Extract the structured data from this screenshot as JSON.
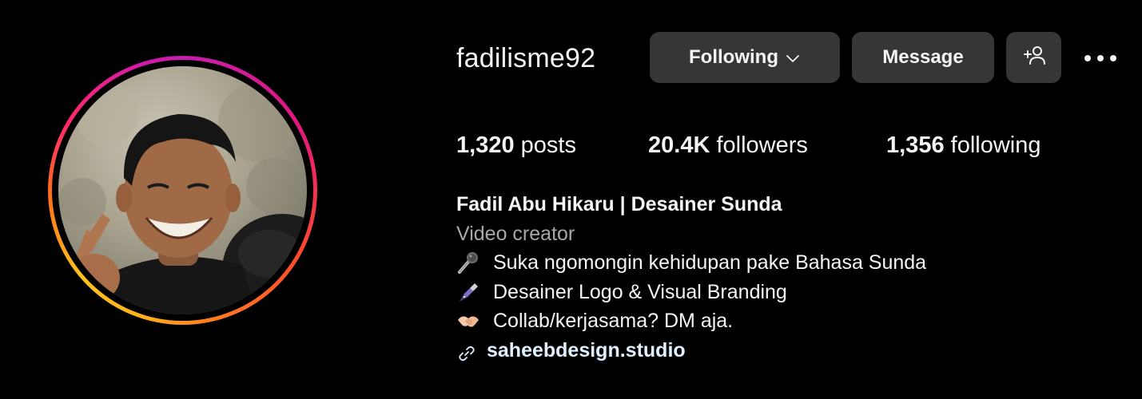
{
  "profile": {
    "username": "fadilisme92",
    "full_name": "Fadil Abu Hikaru | Desainer Sunda",
    "category": "Video creator",
    "bio_lines": [
      {
        "icon": "microphone-icon",
        "text": "Suka ngomongin kehidupan pake Bahasa Sunda"
      },
      {
        "icon": "fountain-pen-icon",
        "text": "Desainer Logo & Visual Branding"
      },
      {
        "icon": "handshake-icon",
        "text": "Collab/kerjasama? DM aja."
      }
    ],
    "link": {
      "icon": "link-icon",
      "text": "saheebdesign.studio"
    }
  },
  "actions": {
    "following_label": "Following",
    "message_label": "Message",
    "suggest_icon": "add-person-icon",
    "more_icon": "more-options-icon"
  },
  "stats": {
    "posts_count": "1,320",
    "posts_label": "posts",
    "followers_count": "20.4K",
    "followers_label": "followers",
    "following_count": "1,356",
    "following_label": "following"
  },
  "colors": {
    "background": "#000000",
    "button_bg": "#363636",
    "text_primary": "#f5f5f5",
    "text_secondary": "#a8a8a8",
    "link": "#e0f1ff",
    "story_ring": [
      "#c81db0",
      "#ff2a6a",
      "#ff7f1f",
      "#ffc21a"
    ]
  }
}
